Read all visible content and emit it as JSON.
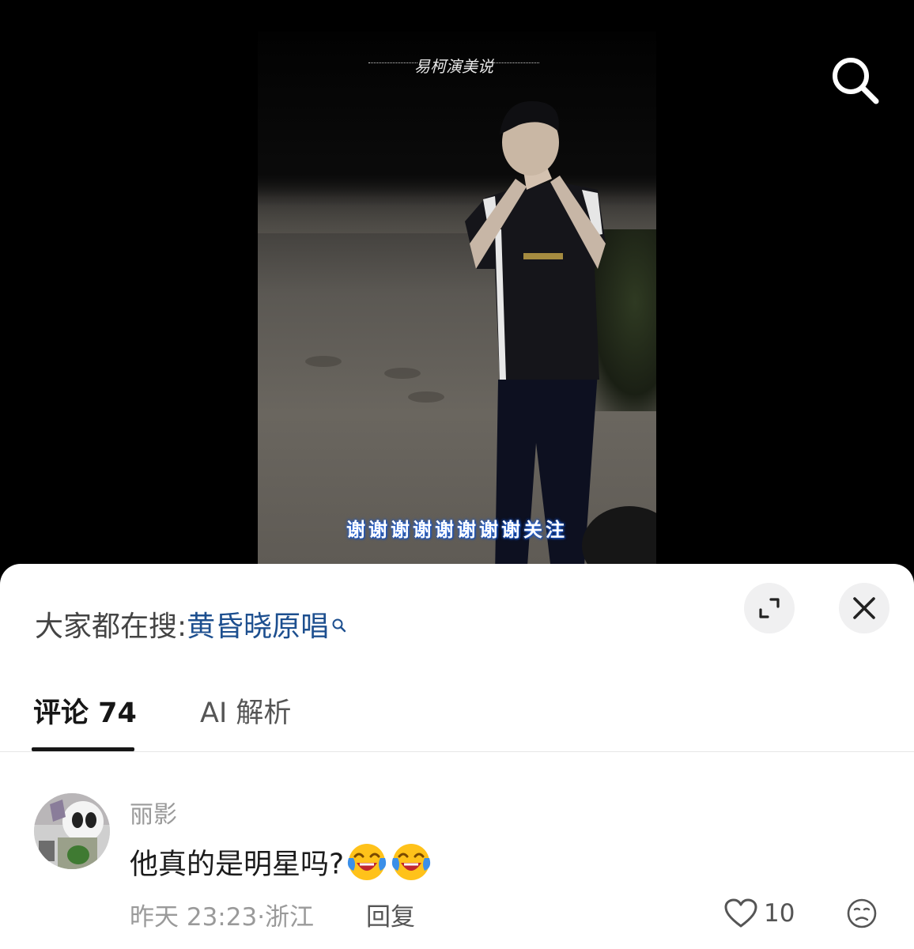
{
  "video": {
    "watermark": "易柯演美说",
    "subtitle": "谢谢谢谢谢谢谢谢关注"
  },
  "header_icons": {
    "search": "search-icon"
  },
  "sheet": {
    "trending_prefix": "大家都在搜:",
    "trending_keyword": "黄昏晓原唱",
    "expand_icon": "expand-icon",
    "close_icon": "close-icon"
  },
  "tabs": [
    {
      "label": "评论 74",
      "active": true
    },
    {
      "label": "AI 解析",
      "active": false
    }
  ],
  "comments": [
    {
      "username": "丽影",
      "text": "他真的是明星吗?",
      "emojis": [
        "laughing-crying-emoji",
        "laughing-crying-emoji"
      ],
      "meta": "昨天 23:23·浙江",
      "reply_label": "回复",
      "likes": "10",
      "dislike_icon": "unhappy-face-icon"
    }
  ],
  "colors": {
    "keyword": "#1d4f8f",
    "subtitle_glow": "#1e5fd6",
    "sheet_bg": "#ffffff"
  }
}
